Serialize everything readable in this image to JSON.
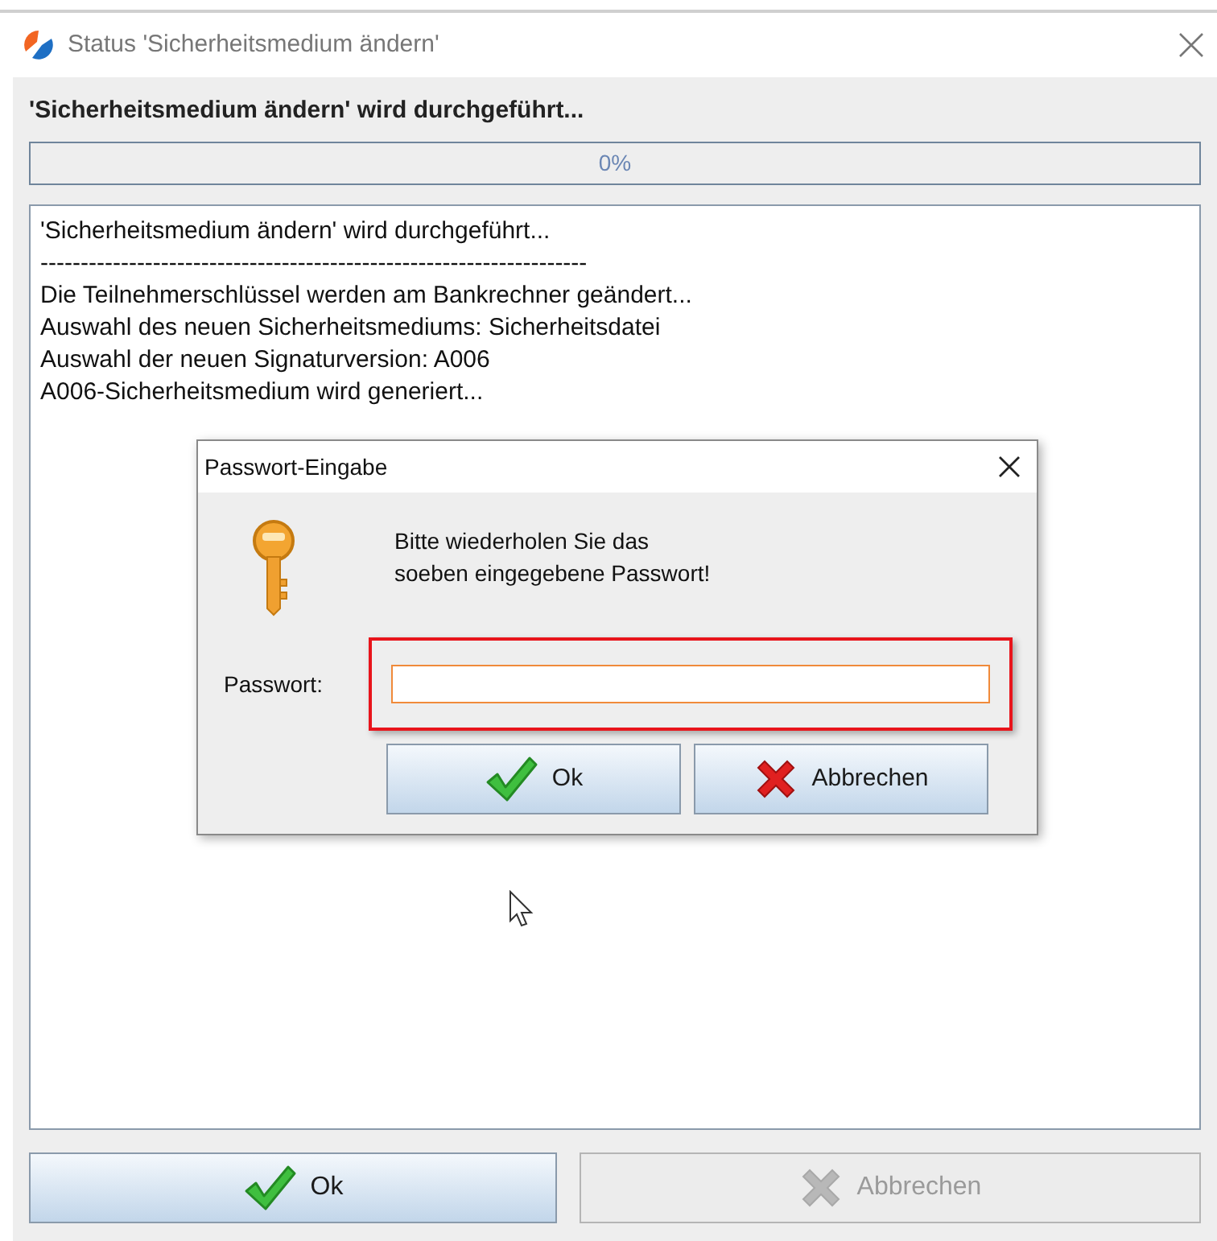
{
  "window": {
    "title": "Status 'Sicherheitsmedium ändern'"
  },
  "heading": "'Sicherheitsmedium ändern' wird durchgeführt...",
  "progress": {
    "level": 0,
    "reading": "0%"
  },
  "log": [
    "'Sicherheitsmedium ändern' wird durchgeführt...",
    "--------------------------------------------------------------------",
    "Die Teilnehmerschlüssel werden am Bankrechner geändert...",
    "Auswahl des neuen Sicherheitsmediums: Sicherheitsdatei",
    "Auswahl der neuen Signaturversion: A006",
    "A006-Sicherheitsmedium wird generiert..."
  ],
  "dialog": {
    "title": "Passwort-Eingabe",
    "message_lines": [
      "Bitte wiederholen Sie das",
      "soeben eingegebene Passwort!"
    ],
    "field_label": "Passwort:",
    "highlighted": true,
    "buttons": [
      {
        "kind": "ok",
        "label": "Ok",
        "disabled": false
      },
      {
        "kind": "cancel",
        "label": "Abbrechen",
        "disabled": false
      }
    ]
  },
  "buttons": [
    {
      "kind": "ok",
      "label": "Ok",
      "disabled": false
    },
    {
      "kind": "cancel",
      "label": "Abbrechen",
      "disabled": true
    }
  ]
}
